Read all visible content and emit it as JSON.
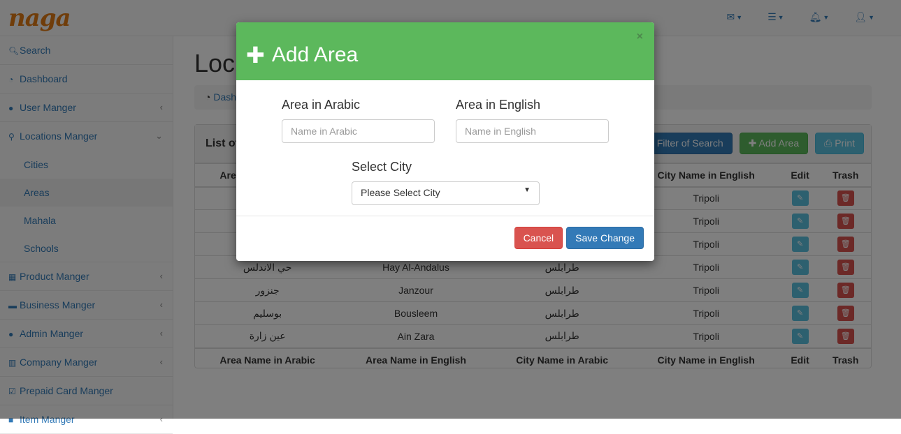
{
  "brand": {
    "logo": "naga"
  },
  "topbar": {
    "icons": [
      "envelope-icon",
      "tasks-icon",
      "bell-icon",
      "user-icon"
    ]
  },
  "sidebar": {
    "items": [
      {
        "label": "Search",
        "icon": "search-icon",
        "arrow": ""
      },
      {
        "label": "Dashboard",
        "icon": "dashboard-icon",
        "arrow": ""
      },
      {
        "label": "User Manger",
        "icon": "user-icon",
        "arrow": "‹"
      },
      {
        "label": "Locations Manger",
        "icon": "map-marker-icon",
        "arrow": "⌄"
      }
    ],
    "subitems": [
      "Cities",
      "Areas",
      "Mahala",
      "Schools"
    ],
    "items2": [
      {
        "label": "Product Manger",
        "icon": "gift-icon",
        "arrow": "‹"
      },
      {
        "label": "Business Manger",
        "icon": "briefcase-icon",
        "arrow": "‹"
      },
      {
        "label": "Admin Manger",
        "icon": "user-icon",
        "arrow": "‹"
      },
      {
        "label": "Company Manger",
        "icon": "building-icon",
        "arrow": "‹"
      },
      {
        "label": "Prepaid Card Manger",
        "icon": "check-square-icon",
        "arrow": ""
      },
      {
        "label": "Item Manger",
        "icon": "item-icon",
        "arrow": "‹"
      }
    ]
  },
  "page": {
    "title": "Loc",
    "breadcrumb": "Dash",
    "panel_title": "List of",
    "buttons": {
      "filter": "Filter of Search",
      "add": "Add Area",
      "print": "Print"
    }
  },
  "table": {
    "headers": [
      "Area Name in Arabic",
      "Area Name in English",
      "City Name in Arabic",
      "City Name in English",
      "Edit",
      "Trash"
    ],
    "rows": [
      [
        "",
        "",
        "",
        "Tripoli"
      ],
      [
        "",
        "",
        "",
        "Tripoli"
      ],
      [
        "",
        "",
        "",
        "Tripoli"
      ],
      [
        "حي الاندلس",
        "Hay Al-Andalus",
        "طرابلس",
        "Tripoli"
      ],
      [
        "جنزور",
        "Janzour",
        "طرابلس",
        "Tripoli"
      ],
      [
        "بوسليم",
        "Bousleem",
        "طرابلس",
        "Tripoli"
      ],
      [
        "عين زارة",
        "Ain Zara",
        "طرابلس",
        "Tripoli"
      ]
    ]
  },
  "modal": {
    "title": "Add Area",
    "close": "×",
    "arabic_label": "Area in Arabic",
    "arabic_placeholder": "Name in Arabic",
    "english_label": "Area in English",
    "english_placeholder": "Name in English",
    "city_label": "Select City",
    "city_selected": "Please Select City",
    "cancel": "Cancel",
    "save": "Save Change"
  },
  "colors": {
    "success": "#5cb85c",
    "primary": "#337ab7",
    "danger": "#d9534f",
    "info": "#5bc0de"
  }
}
